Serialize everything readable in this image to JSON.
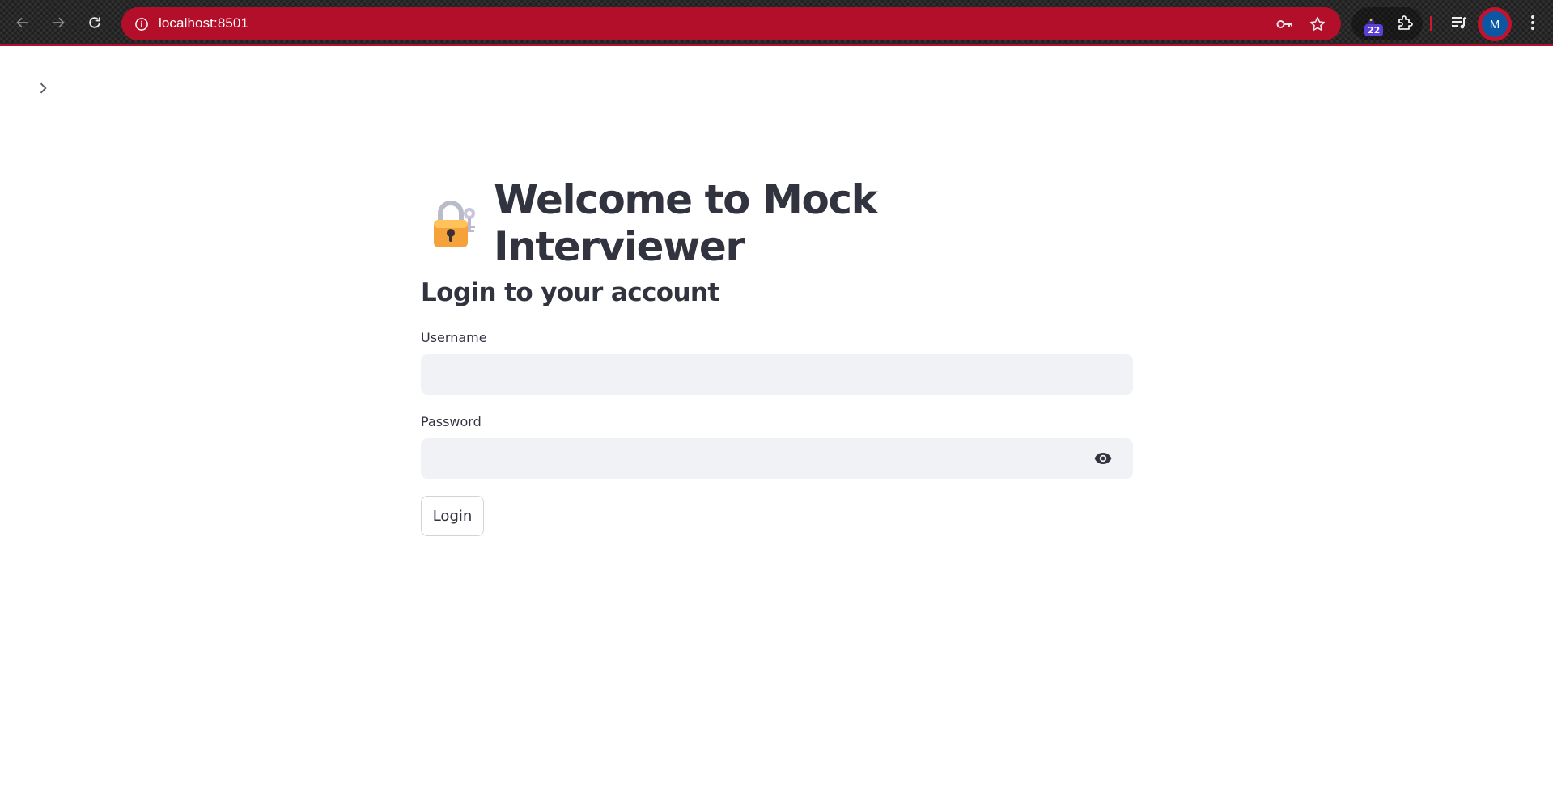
{
  "browser": {
    "url": "localhost:8501",
    "extension_badge": "22",
    "profile_initial": "M",
    "accent_color": "#b30e2a",
    "icons": {
      "back": "back-arrow-icon",
      "forward": "forward-arrow-icon",
      "reload": "reload-icon",
      "site_info": "info-circle-icon",
      "password_key": "key-icon",
      "bookmark": "star-icon",
      "extension": "wizard-hat-icon",
      "extensions_menu": "puzzle-icon",
      "media": "playlist-icon",
      "menu": "kebab-menu-icon"
    }
  },
  "page": {
    "sidebar_toggle_icon": "chevron-right-icon",
    "title_emoji": "lock-with-key-emoji",
    "title": "Welcome to Mock Interviewer",
    "subtitle": "Login to your account",
    "form": {
      "username_label": "Username",
      "username_value": "",
      "password_label": "Password",
      "password_value": "",
      "password_toggle_icon": "eye-icon",
      "login_button": "Login"
    },
    "text_color": "#31333f",
    "input_bg": "#f0f2f6"
  }
}
